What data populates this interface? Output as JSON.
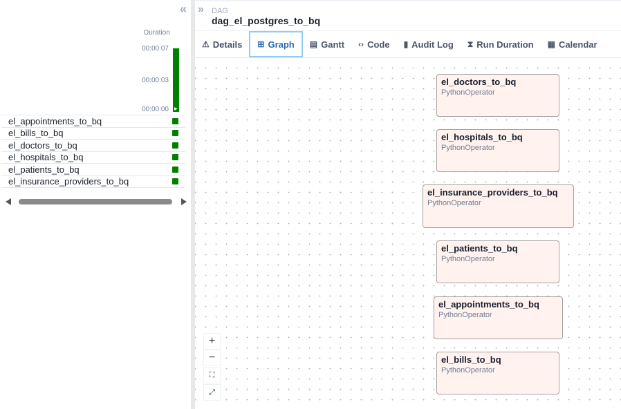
{
  "left": {
    "duration_label": "Duration",
    "ticks": [
      "00:00:07",
      "00:00:03",
      "00:00:00"
    ],
    "run_duration_fraction": 1.0,
    "status_color": "#008000",
    "tasks": [
      "el_appointments_to_bq",
      "el_bills_to_bq",
      "el_doctors_to_bq",
      "el_hospitals_to_bq",
      "el_patients_to_bq",
      "el_insurance_providers_to_bq"
    ]
  },
  "header": {
    "dag_label": "DAG",
    "dag_title": "dag_el_postgres_to_bq"
  },
  "tabs": [
    {
      "label": "Details",
      "icon": "warning-icon"
    },
    {
      "label": "Graph",
      "icon": "graph-icon"
    },
    {
      "label": "Gantt",
      "icon": "gantt-icon"
    },
    {
      "label": "Code",
      "icon": "code-icon"
    },
    {
      "label": "Audit Log",
      "icon": "audit-log-icon"
    },
    {
      "label": "Run Duration",
      "icon": "hourglass-icon"
    },
    {
      "label": "Calendar",
      "icon": "calendar-icon"
    }
  ],
  "active_tab": "Graph",
  "graph": {
    "nodes": [
      {
        "name": "el_doctors_to_bq",
        "operator": "PythonOperator"
      },
      {
        "name": "el_hospitals_to_bq",
        "operator": "PythonOperator"
      },
      {
        "name": "el_insurance_providers_to_bq",
        "operator": "PythonOperator"
      },
      {
        "name": "el_patients_to_bq",
        "operator": "PythonOperator"
      },
      {
        "name": "el_appointments_to_bq",
        "operator": "PythonOperator"
      },
      {
        "name": "el_bills_to_bq",
        "operator": "PythonOperator"
      }
    ],
    "node_fill": "#fff2ef"
  },
  "zoom_controls": [
    {
      "icon": "zoom-in-icon",
      "glyph": "+"
    },
    {
      "icon": "zoom-out-icon",
      "glyph": "−"
    },
    {
      "icon": "fit-view-icon",
      "glyph": "⛶"
    },
    {
      "icon": "reset-view-icon",
      "glyph": "⤢"
    }
  ]
}
